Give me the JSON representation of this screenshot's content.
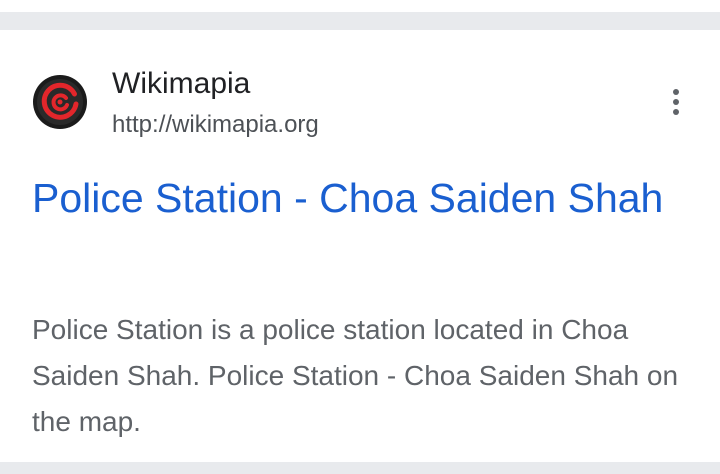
{
  "result": {
    "site_name": "Wikimapia",
    "site_url": "http://wikimapia.org",
    "favicon_icon": "wikimapia-logo-icon",
    "more_icon": "more-vert-icon",
    "title": "Police Station - Choa Saiden Shah",
    "snippet": "Police Station is a police station located in Choa Saiden Shah. Police Station - Choa Saiden Shah on the map."
  },
  "colors": {
    "title_link": "#1a5fd0",
    "snippet_text": "#5f6368",
    "logo_red": "#e3262b",
    "logo_dark": "#1b1b1b",
    "background_gray": "#e8eaed"
  }
}
